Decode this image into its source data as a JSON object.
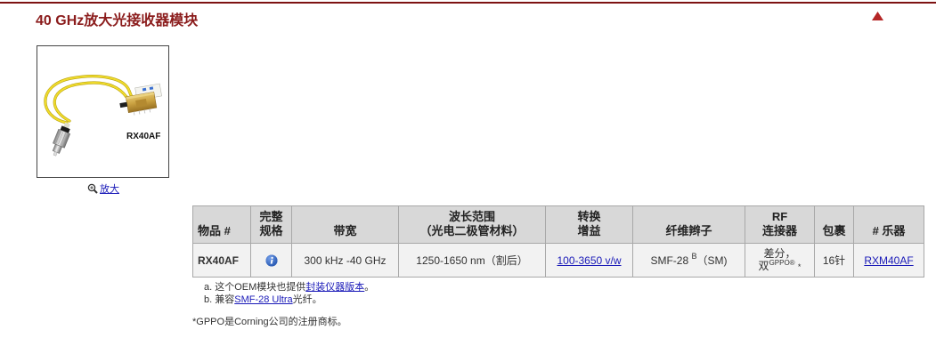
{
  "colors": {
    "title": "#8b1c1c",
    "top_rule": "#7d1212",
    "back_to_top": "#b52626",
    "link": "#1a1ab8",
    "header_bg": "#d8d8d8",
    "row_bg": "#f2f2f2",
    "border": "#a8a8a8",
    "info_icon": "#2b63c6"
  },
  "header": {
    "title": "40 GHz放大光接收器模块",
    "back_to_top_icon": "triangle-up-icon"
  },
  "product_image": {
    "label": "RX40AF",
    "zoom_icon": "magnifier-icon",
    "zoom_link": "放大"
  },
  "table": {
    "headers": [
      "物品 #",
      "完整\n规格",
      "带宽",
      "波长范围\n（光电二极管材料）",
      "转换\n增益",
      "纤维辫子",
      "RF\n连接器",
      "包裹",
      "# 乐器"
    ],
    "row": {
      "item": "RX40AF",
      "spec_icon": "info-icon",
      "bandwidth": "300 kHz -40 GHz",
      "wavelength": "1250-1650 nm（割后）",
      "gain": "100-3650 v/w",
      "fiber": {
        "text": "SMF-28",
        "sup": "B",
        "suffix": "（SM)"
      },
      "rf_connector": {
        "line1": "差分，",
        "line2": "双",
        "line2_sup": "GPPO®",
        "line2_note": "*"
      },
      "package": "16针",
      "instrument": "RXM40AF"
    }
  },
  "footnotes": [
    {
      "prefix": "a. 这个OEM模块也提供",
      "link": "封装仪器版本",
      "suffix": "。"
    },
    {
      "prefix": "b. 兼容",
      "link": "SMF-28 Ultra",
      "suffix": "光纤。"
    }
  ],
  "trademark_note": "*GPPO是Corning公司的注册商标。"
}
